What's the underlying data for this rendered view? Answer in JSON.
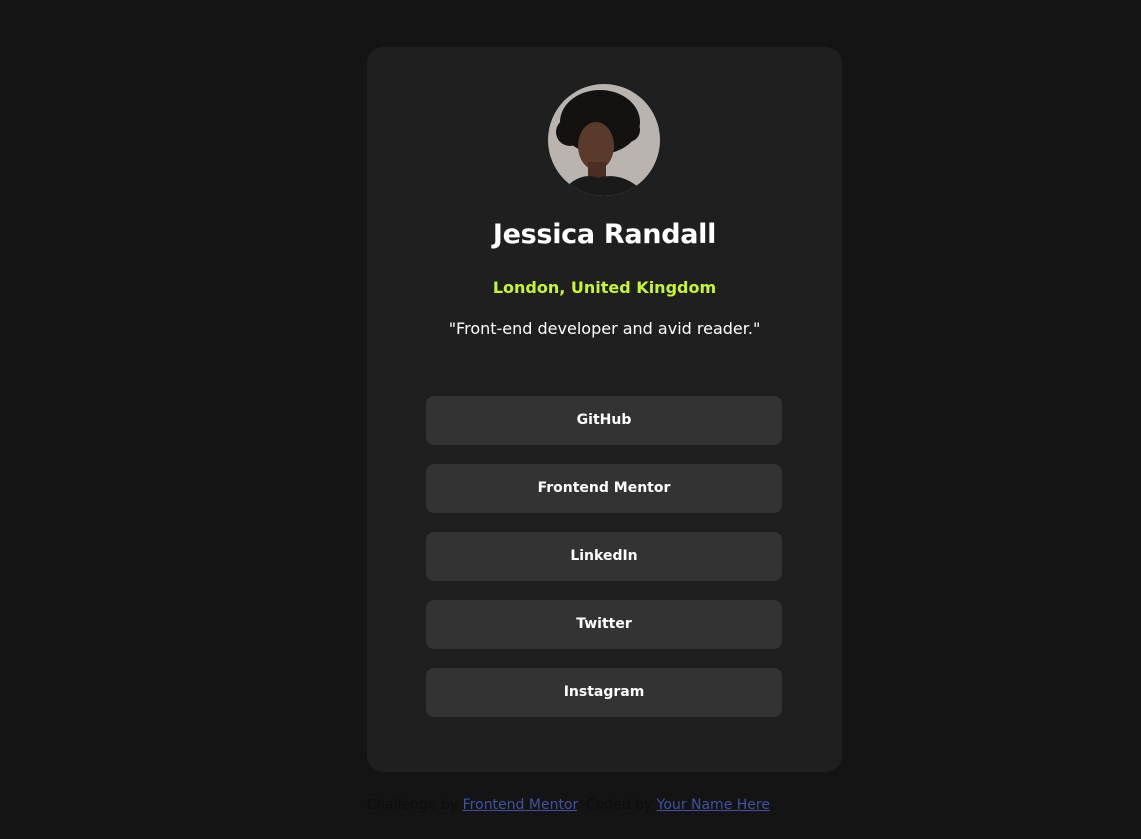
{
  "profile": {
    "avatar_icon": "profile-photo",
    "name": "Jessica Randall",
    "location": "London, United Kingdom",
    "bio": "\"Front-end developer and avid reader.\""
  },
  "links": [
    {
      "label": "GitHub"
    },
    {
      "label": "Frontend Mentor"
    },
    {
      "label": "LinkedIn"
    },
    {
      "label": "Twitter"
    },
    {
      "label": "Instagram"
    }
  ],
  "footer": {
    "prefix": "Challenge by",
    "challenge_link": "Frontend Mentor",
    "middle": ". Coded by",
    "author_link": "Your Name Here",
    "suffix": "."
  },
  "colors": {
    "background": "#141414",
    "card": "#1f1f1f",
    "button": "#333333",
    "accent": "#c5f82a",
    "text": "#ffffff",
    "link": "#3e52a3"
  }
}
